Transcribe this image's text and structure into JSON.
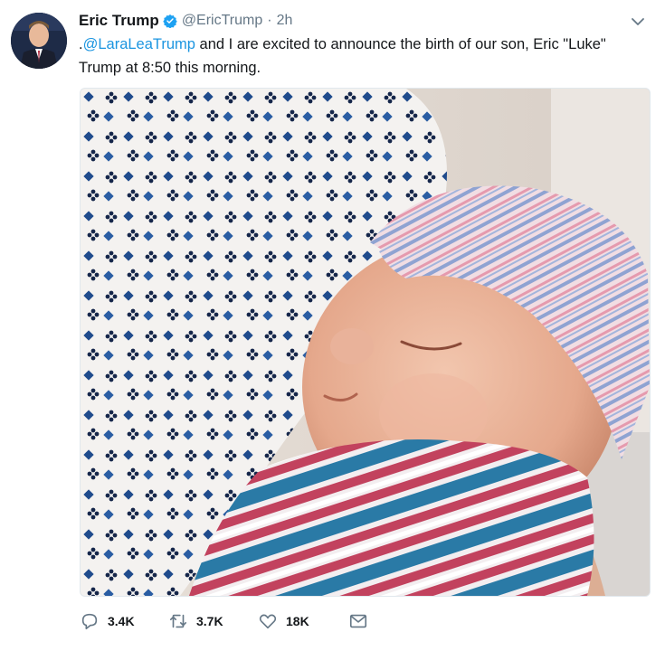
{
  "tweet": {
    "author_name": "Eric Trump",
    "handle": "@EricTrump",
    "separator": "·",
    "time": "2h",
    "text_prefix": ".",
    "mention": "@LaraLeaTrump",
    "text_rest": " and I are excited to announce the birth of our son, Eric \"Luke\" Trump at 8:50 this morning."
  },
  "actions": {
    "reply_count": "3.4K",
    "retweet_count": "3.7K",
    "like_count": "18K"
  },
  "icons": {
    "verified": "verified-badge-icon",
    "caret": "chevron-down-icon",
    "reply": "reply-bubble-icon",
    "retweet": "retweet-icon",
    "like": "heart-icon",
    "dm": "envelope-icon"
  },
  "colors": {
    "text": "#14171a",
    "muted": "#657786",
    "link": "#1b95e0",
    "verified": "#1da1f2"
  }
}
